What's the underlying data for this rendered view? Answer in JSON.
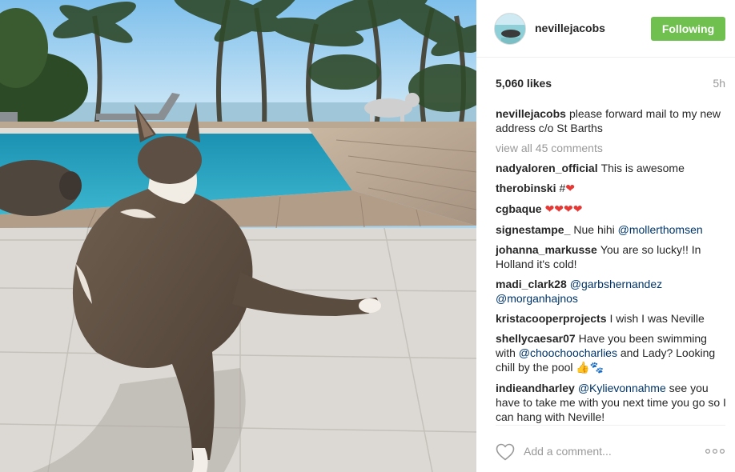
{
  "post": {
    "username": "nevillejacobs",
    "follow_label": "Following",
    "likes": "5,060 likes",
    "time": "5h",
    "caption": "please forward mail to my new address c/o St Barths",
    "view_all": "view all 45 comments"
  },
  "comments": [
    {
      "user": "nadyaloren_official",
      "parts": [
        {
          "t": "text",
          "v": "This is awesome"
        }
      ]
    },
    {
      "user": "therobinski",
      "parts": [
        {
          "t": "text",
          "v": "#"
        },
        {
          "t": "emoji",
          "v": "❤"
        }
      ]
    },
    {
      "user": "cgbaque",
      "parts": [
        {
          "t": "emoji",
          "v": "❤❤❤❤"
        }
      ]
    },
    {
      "user": "signestampe_",
      "parts": [
        {
          "t": "text",
          "v": "Nue hihi "
        },
        {
          "t": "mention",
          "v": "@mollerthomsen"
        }
      ]
    },
    {
      "user": "johanna_markusse",
      "parts": [
        {
          "t": "text",
          "v": "You are so lucky!! In Holland it's cold!"
        }
      ]
    },
    {
      "user": "madi_clark28",
      "parts": [
        {
          "t": "mention",
          "v": "@garbshernandez"
        },
        {
          "t": "text",
          "v": " "
        },
        {
          "t": "mention",
          "v": "@morganhajnos"
        }
      ]
    },
    {
      "user": "kristacooperprojects",
      "parts": [
        {
          "t": "text",
          "v": "I wish I was Neville"
        }
      ]
    },
    {
      "user": "shellycaesar07",
      "parts": [
        {
          "t": "text",
          "v": "Have you been swimming with "
        },
        {
          "t": "mention",
          "v": "@choochoocharlies"
        },
        {
          "t": "text",
          "v": " and Lady? Looking chill by the pool "
        },
        {
          "t": "emoji-thumb",
          "v": "👍"
        },
        {
          "t": "emoji-paw",
          "v": "🐾"
        }
      ]
    },
    {
      "user": "indieandharley",
      "parts": [
        {
          "t": "mention",
          "v": "@Kylievonnahme"
        },
        {
          "t": "text",
          "v": " see you have to take me with you next time you go so I can hang with Neville!"
        }
      ]
    }
  ],
  "footer": {
    "comment_placeholder": "Add a comment...",
    "heart_icon": "heart-outline-icon",
    "more_icon": "more-options-icon"
  },
  "colors": {
    "follow": "#70c050",
    "mention": "#003569",
    "muted": "#999999"
  }
}
